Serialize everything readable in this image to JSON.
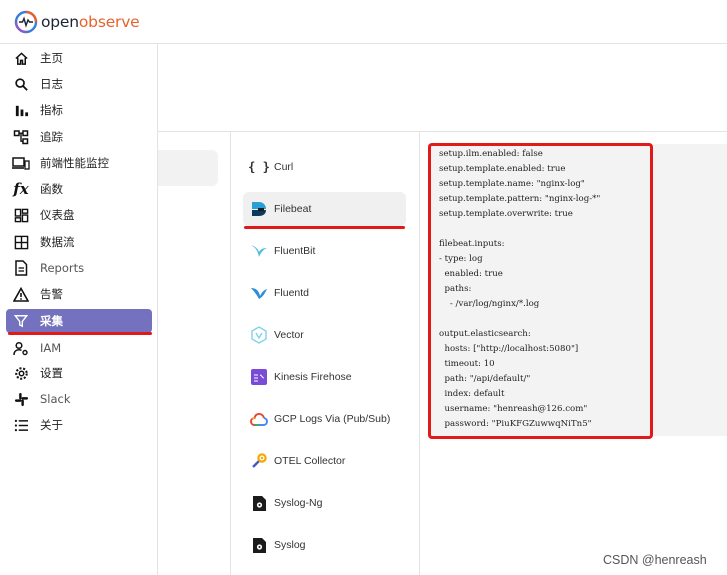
{
  "app": {
    "logo_part1": "open",
    "logo_part2": "observe"
  },
  "sidebar": {
    "items": [
      {
        "label": "主页",
        "icon": "home-icon"
      },
      {
        "label": "日志",
        "icon": "search-icon"
      },
      {
        "label": "指标",
        "icon": "bar-chart-icon"
      },
      {
        "label": "追踪",
        "icon": "trace-icon"
      },
      {
        "label": "前端性能监控",
        "icon": "devices-icon"
      },
      {
        "label": "函数",
        "icon": "function-icon"
      },
      {
        "label": "仪表盘",
        "icon": "dashboard-icon"
      },
      {
        "label": "数据流",
        "icon": "grid-icon"
      },
      {
        "label": "Reports",
        "icon": "document-icon"
      },
      {
        "label": "告警",
        "icon": "warning-icon"
      },
      {
        "label": "采集",
        "icon": "filter-icon",
        "active": true
      },
      {
        "label": "IAM",
        "icon": "user-gear-icon"
      },
      {
        "label": "设置",
        "icon": "gear-icon"
      },
      {
        "label": "Slack",
        "icon": "slack-icon"
      },
      {
        "label": "关于",
        "icon": "list-icon"
      }
    ]
  },
  "sources": [
    {
      "label": "Curl",
      "icon": "curl-icon"
    },
    {
      "label": "Filebeat",
      "icon": "filebeat-icon",
      "selected": true
    },
    {
      "label": "FluentBit",
      "icon": "fluentbit-icon"
    },
    {
      "label": "Fluentd",
      "icon": "fluentd-icon"
    },
    {
      "label": "Vector",
      "icon": "vector-icon"
    },
    {
      "label": "Kinesis Firehose",
      "icon": "kinesis-icon"
    },
    {
      "label": "GCP Logs Via (Pub/Sub)",
      "icon": "gcp-icon"
    },
    {
      "label": "OTEL Collector",
      "icon": "otel-icon"
    },
    {
      "label": "Syslog-Ng",
      "icon": "syslog-ng-icon"
    },
    {
      "label": "Syslog",
      "icon": "syslog-icon"
    }
  ],
  "config_lines": [
    "setup.ilm.enabled: false",
    "setup.template.enabled: true",
    "setup.template.name: \"nginx-log\"",
    "setup.template.pattern: \"nginx-log-*\"",
    "setup.template.overwrite: true",
    "",
    "filebeat.inputs:",
    "- type: log",
    "  enabled: true",
    "  paths:",
    "    - /var/log/nginx/*.log",
    "",
    "output.elasticsearch:",
    "  hosts: [\"http://localhost:5080\"]",
    "  timeout: 10",
    "  path: \"/api/default/\"",
    "  index: default",
    "  username: \"henreash@126.com\"",
    "  password: \"PiuKFGZuwwqNiTn5\""
  ],
  "watermark": "CSDN @henreash",
  "colors": {
    "active_nav": "#7472be",
    "annotation_red": "#e11919",
    "logo_accent": "#e8622c"
  }
}
